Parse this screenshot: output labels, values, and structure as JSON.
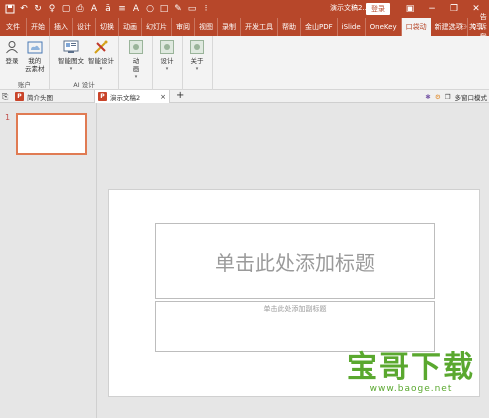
{
  "titlebar": {
    "doc_title": "演示文稿2...",
    "login_label": "登录"
  },
  "tabs": [
    {
      "label": "文件",
      "name": "tab-file"
    },
    {
      "label": "开始",
      "name": "tab-home"
    },
    {
      "label": "插入",
      "name": "tab-insert"
    },
    {
      "label": "设计",
      "name": "tab-design"
    },
    {
      "label": "切换",
      "name": "tab-transitions"
    },
    {
      "label": "动画",
      "name": "tab-animations"
    },
    {
      "label": "幻灯片",
      "name": "tab-slideshow"
    },
    {
      "label": "审阅",
      "name": "tab-review"
    },
    {
      "label": "视图",
      "name": "tab-view"
    },
    {
      "label": "录制",
      "name": "tab-record"
    },
    {
      "label": "开发工具",
      "name": "tab-developer"
    },
    {
      "label": "帮助",
      "name": "tab-help"
    },
    {
      "label": "金山PDF",
      "name": "tab-pdf"
    },
    {
      "label": "iSlide",
      "name": "tab-islide"
    },
    {
      "label": "OneKey",
      "name": "tab-onekey"
    },
    {
      "label": "口袋动",
      "name": "tab-pocket"
    },
    {
      "label": "新建选项",
      "name": "tab-new"
    }
  ],
  "tell_me": "告诉我",
  "share": "共享",
  "ribbon": {
    "login": "登录",
    "cloud": "我的\n云素材",
    "account_group": "账户",
    "smart_img": "智能图文",
    "smart_design": "智能设计",
    "ai_group": "AI 设计",
    "anim": "动\n画",
    "design": "设计",
    "about": "关于"
  },
  "docstrip": {
    "tab1": "简介头图",
    "tab2": "演示文稿2",
    "multi_window": "多窗口模式"
  },
  "slide_pane": {
    "slide_number": "1"
  },
  "slide": {
    "title_placeholder": "单击此处添加标题",
    "subtitle_placeholder": "单击此处添加副标题"
  },
  "watermark": {
    "text": "宝哥下载",
    "url": "www.baoge.net"
  },
  "colors": {
    "accent": "#b7472a",
    "watermark": "#5aa82f"
  }
}
